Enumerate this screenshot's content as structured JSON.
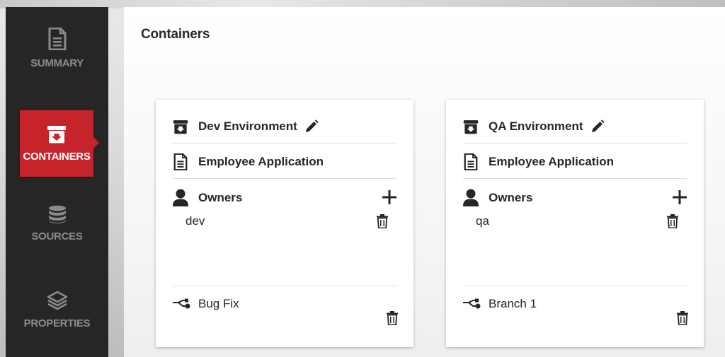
{
  "sidebar": {
    "items": [
      {
        "label": "SUMMARY",
        "icon": "document-icon",
        "active": false
      },
      {
        "label": "CONTAINERS",
        "icon": "archive-box-icon",
        "active": true
      },
      {
        "label": "SOURCES",
        "icon": "database-icon",
        "active": false
      },
      {
        "label": "PROPERTIES",
        "icon": "layers-icon",
        "active": false
      }
    ]
  },
  "main": {
    "title": "Containers",
    "cards": [
      {
        "environment": "Dev Environment",
        "application": "Employee Application",
        "owners_label": "Owners",
        "owners": [
          "dev"
        ],
        "branch": "Bug Fix"
      },
      {
        "environment": "QA Environment",
        "application": "Employee Application",
        "owners_label": "Owners",
        "owners": [
          "qa"
        ],
        "branch": "Branch 1"
      }
    ]
  },
  "colors": {
    "sidebar_bg": "#262626",
    "active_item": "#c6242b",
    "inactive_text": "#8c8c8c",
    "text": "#262626"
  }
}
